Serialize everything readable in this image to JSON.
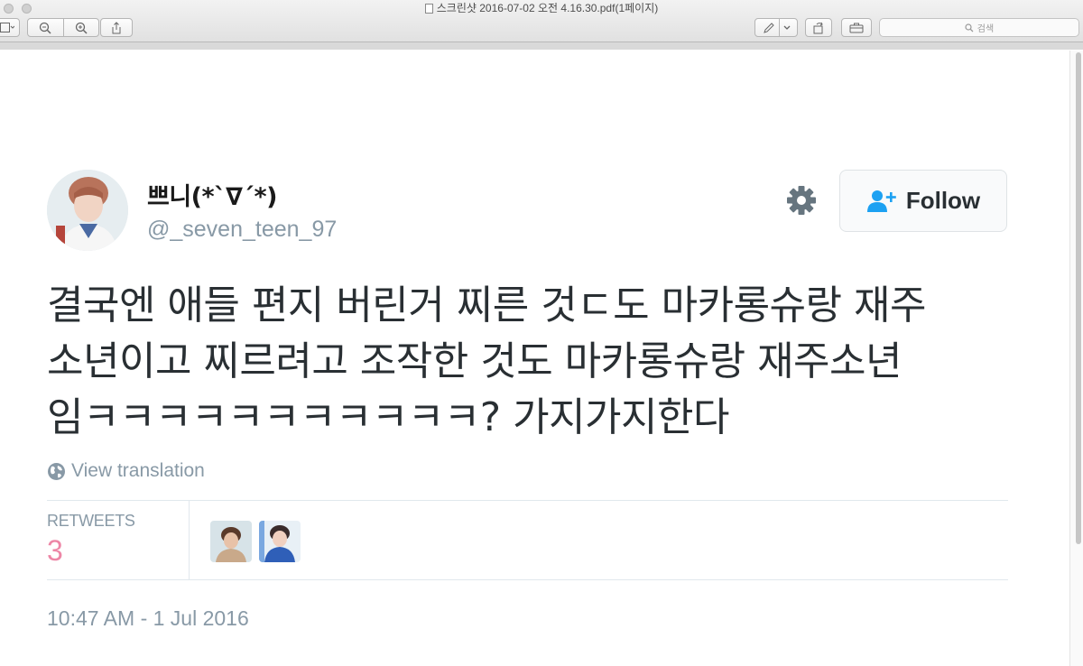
{
  "window": {
    "title": "스크린샷 2016-07-02 오전 4.16.30.pdf(1페이지)",
    "search_placeholder": "검색",
    "toolbar_icons": [
      "sidebar-icon",
      "zoom-out-icon",
      "zoom-in-icon",
      "share-icon",
      "markup-pen-icon",
      "rotate-icon",
      "toolbox-icon",
      "search-icon"
    ]
  },
  "tweet": {
    "display_name": "쁘니(*ˋ∇ˊ*)",
    "handle": "@_seven_teen_97",
    "follow_label": "Follow",
    "text_lines": [
      "결국엔 애들 편지 버린거 찌른 것ㄷ도 마카롱슈랑 재주",
      "소년이고 찌르려고 조작한 것도 마카롱슈랑 재주소년",
      "임ㅋㅋㅋㅋㅋㅋㅋㅋㅋㅋㅋ? 가지가지한다"
    ],
    "view_translation": "View translation",
    "stats": {
      "retweets_label": "RETWEETS",
      "retweets_count": "3"
    },
    "timestamp": "10:47 AM - 1 Jul 2016"
  },
  "colors": {
    "handle": "#8899a6",
    "retweet_count": "#e0245e",
    "text": "#292f33"
  }
}
